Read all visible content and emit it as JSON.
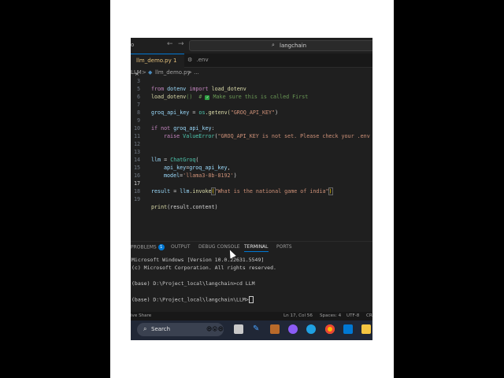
{
  "titlebar": {
    "left_fragment": "o",
    "back_arrow": "←",
    "forward_arrow": "→",
    "search_icon": "⌕",
    "search_text": "langchain"
  },
  "tabs": [
    {
      "label": "llm_demo.py 1",
      "icon": "python-icon",
      "close": "×",
      "active": true
    },
    {
      "label": ".env",
      "icon": "gear-icon",
      "active": false
    }
  ],
  "breadcrumb": {
    "folder": "LLM",
    "sep1": ">",
    "file": "llm_demo.py",
    "sep2": "> ..."
  },
  "editor": {
    "current_line": 17,
    "lines": [
      {
        "n": "3"
      },
      {
        "n": "5"
      },
      {
        "n": "6"
      },
      {
        "n": "7"
      },
      {
        "n": "8"
      },
      {
        "n": "9"
      },
      {
        "n": "10"
      },
      {
        "n": "11"
      },
      {
        "n": "12"
      },
      {
        "n": "13"
      },
      {
        "n": "14"
      },
      {
        "n": "15"
      },
      {
        "n": "16"
      },
      {
        "n": "17"
      },
      {
        "n": "18"
      },
      {
        "n": "19"
      }
    ],
    "code": {
      "l5_kw1": "from",
      "l5_mod": "dotenv",
      "l5_kw2": "import",
      "l5_fn": "load_dotenv",
      "l6_fn": "load_dotenv",
      "l6_rest": "()  #",
      "l6_check": "✓",
      "l6_comment": "Make sure this is called First",
      "l8_var": "groq_api_key",
      "l8_eq": " = ",
      "l8_mod": "os",
      "l8_fn": ".getenv(",
      "l8_str": "\"GROQ_API_KEY\"",
      "l8_end": ")",
      "l10_kw": "if not",
      "l10_var": "groq_api_key",
      "l10_end": ":",
      "l11_kw": "raise",
      "l11_cls": "ValueError",
      "l11_open": "(",
      "l11_str": "\"GROQ_API_KEY is not set. Please check your .env",
      "l13_var": "llm",
      "l13_eq": " = ",
      "l13_cls": "ChatGroq",
      "l13_end": "(",
      "l14_var": "api_key",
      "l14_eq": "=",
      "l14_val": "groq_api_key",
      "l14_end": ",",
      "l15_var": "model",
      "l15_eq": "=",
      "l15_str": "'llama3-8b-8192'",
      "l15_end": ")",
      "l17_var": "result",
      "l17_eq": " = ",
      "l17_obj": "llm",
      "l17_fn": ".invoke",
      "l17_open": "(",
      "l17_str": "\"What is the national game of india\"",
      "l17_end": ")",
      "l19_fn": "print",
      "l19_arg": "(result.content)"
    }
  },
  "panel": {
    "tabs": [
      {
        "label": "PROBLEMS",
        "badge": "1"
      },
      {
        "label": "OUTPUT"
      },
      {
        "label": "DEBUG CONSOLE"
      },
      {
        "label": "TERMINAL",
        "active": true
      },
      {
        "label": "PORTS"
      }
    ]
  },
  "terminal": {
    "lines": [
      "Microsoft Windows [Version 10.0.22631.5549]",
      "(c) Microsoft Corporation. All rights reserved.",
      "",
      "(base) D:\\Project_local\\langchain>cd LLM",
      "",
      "(base) D:\\Project_local\\langchain\\LLM>"
    ]
  },
  "statusbar": {
    "left": "ive Share",
    "position": "Ln 17, Col 56",
    "spaces": "Spaces: 4",
    "encoding": "UTF-8",
    "eol": "CR"
  },
  "taskbar": {
    "search_icon": "⌕",
    "search_label": "Search",
    "emoji": "😄😮😄"
  }
}
